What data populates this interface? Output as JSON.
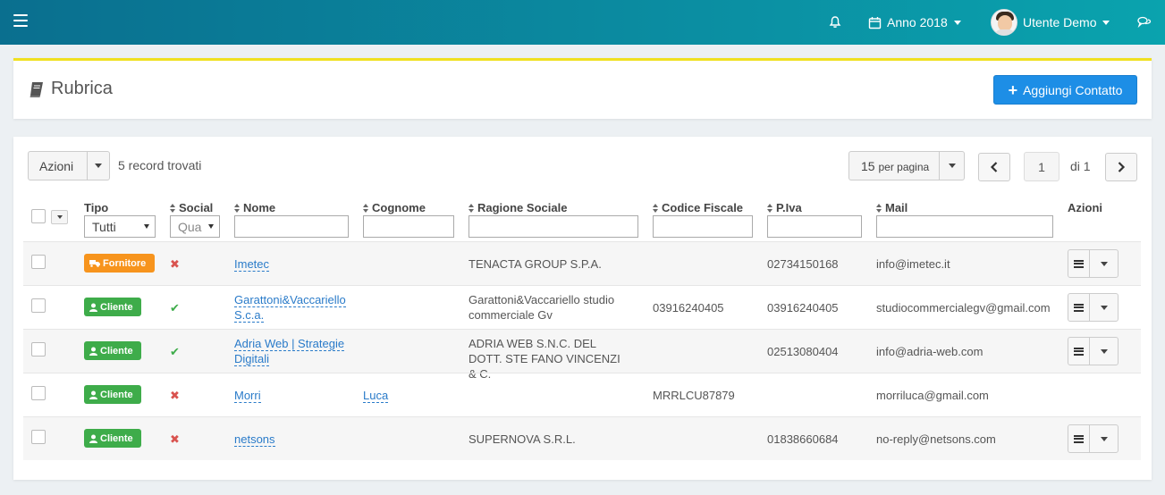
{
  "topbar": {
    "year_label": "Anno 2018",
    "user_label": "Utente Demo"
  },
  "header": {
    "title": "Rubrica",
    "add_button": "Aggiungi Contatto"
  },
  "toolbar": {
    "actions_label": "Azioni",
    "records_found": "5 record trovati",
    "per_page_value": "15",
    "per_page_suffix": "per pagina",
    "current_page": "1",
    "page_of": "di 1"
  },
  "table": {
    "columns": {
      "tipo": "Tipo",
      "social": "Social",
      "nome": "Nome",
      "cognome": "Cognome",
      "ragione_sociale": "Ragione Sociale",
      "codice_fiscale": "Codice Fiscale",
      "piva": "P.Iva",
      "mail": "Mail",
      "azioni": "Azioni"
    },
    "filters": {
      "tipo": "Tutti",
      "social": "Qua"
    },
    "rows": [
      {
        "tipo": "Fornitore",
        "social": "no",
        "nome": "Imetec",
        "cognome": "",
        "ragione_sociale": "TENACTA GROUP S.P.A.",
        "codice_fiscale": "",
        "piva": "02734150168",
        "mail": "info@imetec.it"
      },
      {
        "tipo": "Cliente",
        "social": "yes",
        "nome": "Garattoni&Vaccariello S.c.a.",
        "cognome": "",
        "ragione_sociale": "Garattoni&Vaccariello studio commerciale Gv",
        "codice_fiscale": "03916240405",
        "piva": "03916240405",
        "mail": "studiocommercialegv@gmail.com"
      },
      {
        "tipo": "Cliente",
        "social": "yes",
        "nome": "Adria Web | Strategie Digitali",
        "cognome": "",
        "ragione_sociale": "ADRIA WEB S.N.C. DEL DOTT. STE FANO VINCENZI & C.",
        "codice_fiscale": "",
        "piva": "02513080404",
        "mail": "info@adria-web.com"
      },
      {
        "tipo": "Cliente",
        "social": "no",
        "nome": "Morri",
        "cognome": "Luca",
        "ragione_sociale": "",
        "codice_fiscale": "MRRLCU87879",
        "piva": "",
        "mail": "morriluca@gmail.com"
      },
      {
        "tipo": "Cliente",
        "social": "no",
        "nome": "netsons",
        "cognome": "",
        "ragione_sociale": "SUPERNOVA S.R.L.",
        "codice_fiscale": "",
        "piva": "01838660684",
        "mail": "no-reply@netsons.com"
      }
    ]
  },
  "colors": {
    "topbar_start": "#0a6f8f",
    "topbar_end": "#0aa3ae",
    "primary": "#1d8ee6",
    "fornitore": "#f7941d",
    "cliente": "#3eac4a",
    "link": "#2a7bc9",
    "header_accent": "#f0e020"
  },
  "icons": {
    "menu": "hamburger-icon",
    "notifications": "bell-icon",
    "year": "calendar-icon",
    "chat": "comments-icon",
    "title": "book-icon",
    "fornitore": "truck-icon",
    "cliente": "user-icon"
  }
}
